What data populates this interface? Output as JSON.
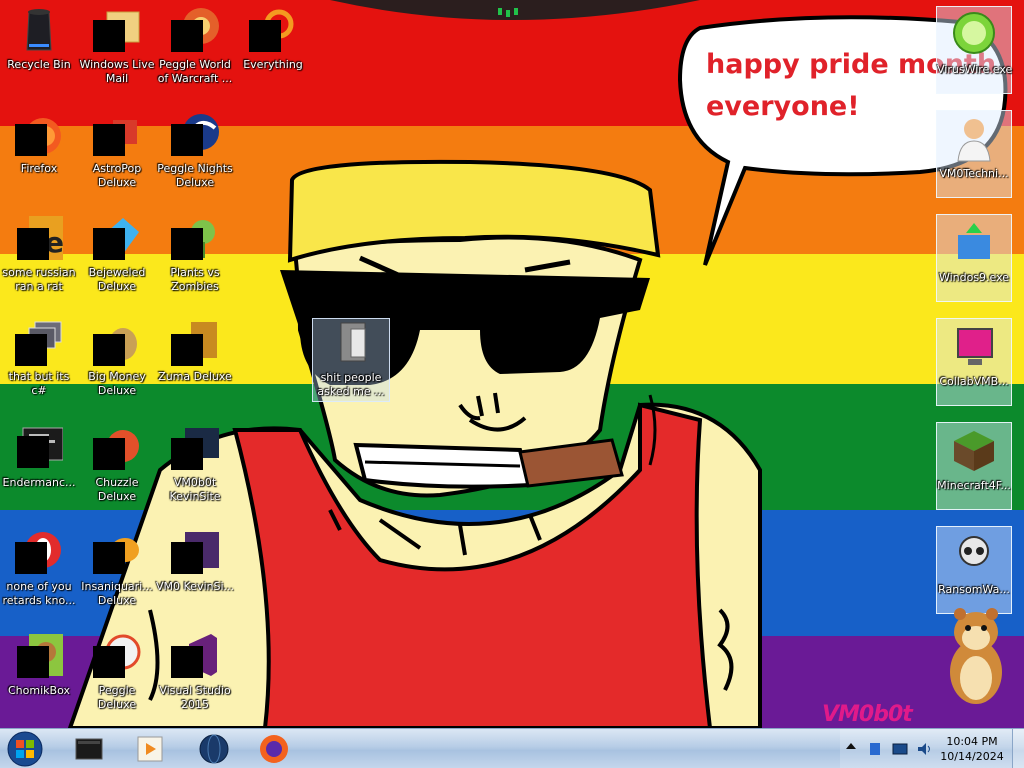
{
  "wallpaper": {
    "stripe_colors": [
      "#e4120f",
      "#f47c10",
      "#fbe81c",
      "#0c8a2c",
      "#1760c8",
      "#6a1a96"
    ],
    "speech_text_line1": "happy pride month",
    "speech_text_line2": "everyone!",
    "watermark": "VM0b0t"
  },
  "desktop_icons": {
    "recycle_bin": "Recycle Bin",
    "wl_mail": "Windows Live Mail",
    "peggle_wow": "Peggle World of Warcraft ...",
    "everything": "Everything",
    "firefox": "Firefox",
    "astropop": "AstroPop Deluxe",
    "peggle_nights": "Peggle Nights Deluxe",
    "russian": "some russian ran a rat",
    "bejeweled": "Bejeweled Deluxe",
    "pvz": "Plants vs Zombies",
    "that_but": "that but its c#",
    "big_money": "Big Money Deluxe",
    "zuma": "Zuma Deluxe",
    "enderman": "Endermanc...",
    "chuzzle": "Chuzzle Deluxe",
    "vm0_site": "VM0b0t KevinSite",
    "none_of_you": "none of you retards kno...",
    "insaniquarium": "Insaniquari... Deluxe",
    "vm0_kevin2": "VM0 KevinSi...",
    "chomikbox": "ChomikBox",
    "peggle_deluxe": "Peggle Deluxe",
    "vs2015": "Visual Studio 2015",
    "center_file": "shit people asked me ..."
  },
  "right_icons": {
    "viruswire": "VirusWire.exe",
    "vm0techni": "VM0Techni...",
    "windos9": "Windos9.exe",
    "collabvm": "CollabVMB...",
    "minecraft": "Minecraft4F...",
    "ransomware": "RansomWa..."
  },
  "taskbar": {
    "time": "10:04 PM",
    "date": "10/14/2024"
  }
}
